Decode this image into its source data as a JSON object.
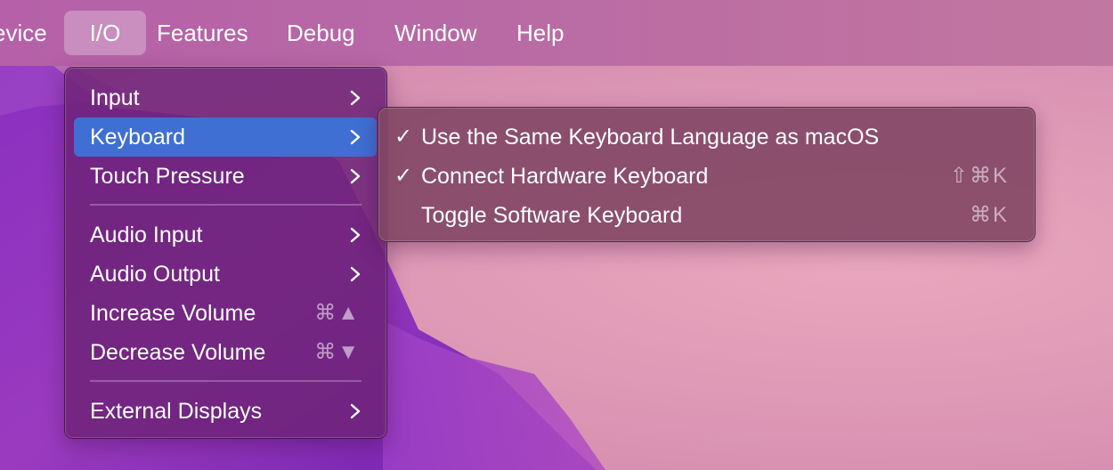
{
  "menubar": {
    "items": [
      {
        "label": "evice",
        "active": false
      },
      {
        "label": "I/O",
        "active": true
      },
      {
        "label": "Features",
        "active": false
      },
      {
        "label": "Debug",
        "active": false
      },
      {
        "label": "Window",
        "active": false
      },
      {
        "label": "Help",
        "active": false
      }
    ]
  },
  "io_menu": {
    "items": [
      {
        "label": "Input",
        "submenu": true
      },
      {
        "label": "Keyboard",
        "submenu": true,
        "highlighted": true
      },
      {
        "label": "Touch Pressure",
        "submenu": true
      },
      {
        "label": "Audio Input",
        "submenu": true
      },
      {
        "label": "Audio Output",
        "submenu": true
      },
      {
        "label": "Increase Volume",
        "shortcut": "⌘▲"
      },
      {
        "label": "Decrease Volume",
        "shortcut": "⌘▼"
      },
      {
        "label": "External Displays",
        "submenu": true
      }
    ]
  },
  "keyboard_menu": {
    "items": [
      {
        "label": "Use the Same Keyboard Language as macOS",
        "checked": true,
        "check_glyph": "✓",
        "shortcut": ""
      },
      {
        "label": "Connect Hardware Keyboard",
        "checked": true,
        "check_glyph": "✓",
        "shortcut": "⇧⌘K"
      },
      {
        "label": "Toggle Software Keyboard",
        "checked": false,
        "check_glyph": "",
        "shortcut": "⌘K"
      }
    ]
  },
  "colors": {
    "highlight": "#3f6fd3",
    "menubar": "#b869a5",
    "wallpaper_pink": "#df9bb6",
    "wallpaper_purple": "#7a2bb8"
  },
  "icons": {
    "submenu": "chevron-right-icon",
    "check": "checkmark-icon"
  }
}
